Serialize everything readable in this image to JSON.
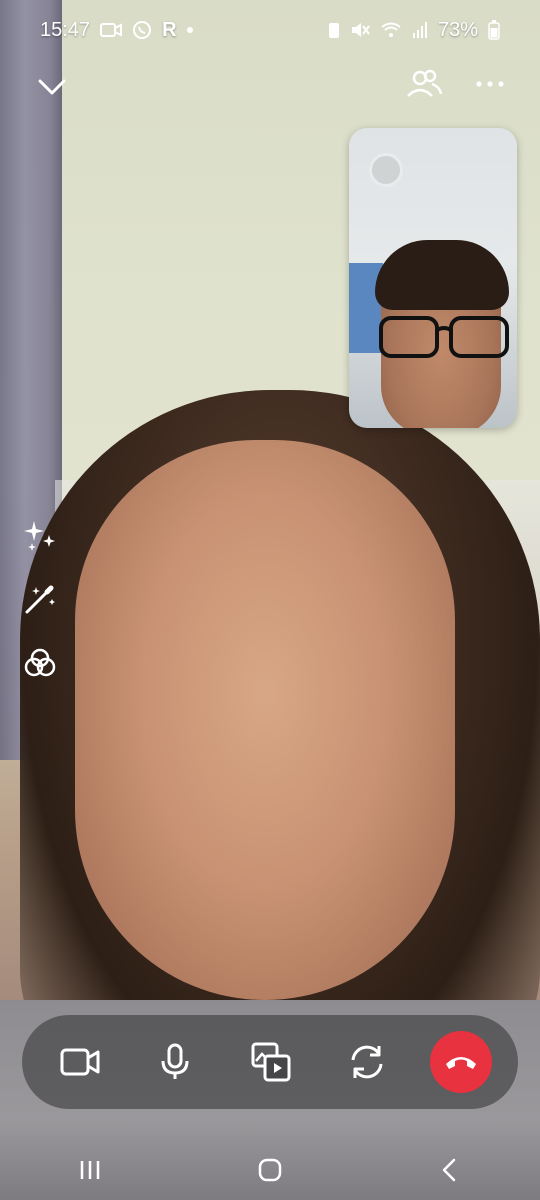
{
  "status_bar": {
    "time": "15:47",
    "carrier_letter": "R",
    "battery_percent": "73%",
    "icons": [
      "video-call-icon",
      "whatsapp-icon",
      "battery-saver-icon",
      "mute-icon",
      "wifi-call-icon",
      "signal-icon",
      "battery-icon"
    ]
  },
  "top_bar": {
    "icons": [
      "chevron-down-icon",
      "participants-icon",
      "more-options-icon"
    ]
  },
  "side_tools": {
    "icons": [
      "sparkles-icon",
      "magic-wand-icon",
      "filters-icon"
    ]
  },
  "controls": {
    "icons": [
      "video-camera-icon",
      "microphone-icon",
      "screen-share-icon",
      "switch-camera-icon",
      "end-call-icon"
    ],
    "end_call_color": "#e8323f"
  },
  "nav_bar": {
    "icons": [
      "recent-apps-icon",
      "home-icon",
      "back-icon"
    ]
  }
}
